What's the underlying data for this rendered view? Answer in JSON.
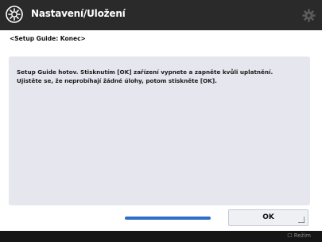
{
  "titlebar": {
    "title": "Nastavení/Uložení",
    "logo_icon": "nastaveni-gear-logo-icon",
    "settings_icon": "gear-icon"
  },
  "header": {
    "label": "<Setup Guide: Konec>"
  },
  "message": {
    "text": "Setup Guide hotov. Stisknutím [OK] zařízení vypnete a zapněte kvůli uplatnění. Ujistěte se, že neprobíhají žádné úlohy, potom stiskněte [OK]."
  },
  "progress": {
    "value": 1.0,
    "fill_color": "#2f6fc7"
  },
  "buttons": {
    "ok_label": "OK"
  },
  "footer": {
    "text": "☐ Režim"
  }
}
